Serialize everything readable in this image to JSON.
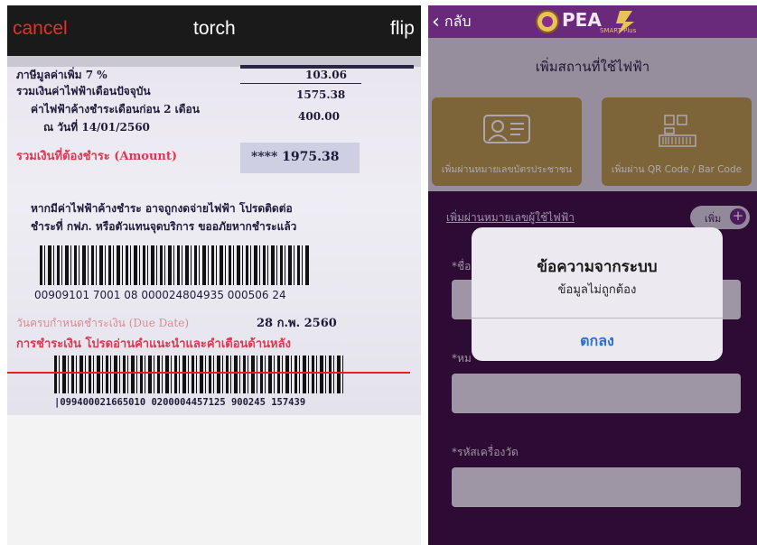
{
  "scanner": {
    "cancel": "cancel",
    "torch": "torch",
    "flip": "flip",
    "bill": {
      "vat_label": "ภาษีมูลค่าเพิ่ม  7 %",
      "vat_value": "103.06",
      "current_label": "รวมเงินค่าไฟฟ้าเดือนปัจจุบัน",
      "current_value": "1575.38",
      "overdue_label": "ค่าไฟฟ้าค้างชำระเดือนก่อน 2 เดือน",
      "overdue_value": "400.00",
      "as_of": "ณ วันที่ 14/01/2560",
      "total_label": "รวมเงินที่ต้องชำระ (Amount)",
      "total_value": "**** 1975.38",
      "notice_line1": "หากมีค่าไฟฟ้าค้างชำระ อาจถูกงดจ่ายไฟฟ้า โปรดติดต่อ",
      "notice_line2": "ชำระที่ กฟภ. หรือตัวแทนจุดบริการ ขออภัยหากชำระแล้ว",
      "barcode1_number": "00909101 7001 08 000024804935 000506 24",
      "due_label": "วันครบกำหนดชำระเงิน (Due Date)",
      "due_value": "28 ก.พ. 2560",
      "payment_note": "การชำระเงิน โปรดอ่านคำแนะนำและคำเตือนด้านหลัง",
      "barcode2_number": "|099400021665010 0200004457125 900245 157439"
    }
  },
  "app": {
    "back_label": "กลับ",
    "logo_text": "PEA",
    "logo_sub": "SMART Plus",
    "page_title": "เพิ่มสถานที่ใช้ไฟฟ้า",
    "tiles": [
      {
        "label": "เพิ่มผ่านหมายเลขบัตรประชาชน",
        "icon": "id-card-icon"
      },
      {
        "label": "เพิ่มผ่าน QR Code / Bar Code",
        "icon": "qr-barcode-icon"
      }
    ],
    "add_link": "เพิ่มผ่านหมายเลขผู้ใช้ไฟฟ้า",
    "add_button": "เพิ่ม",
    "fields": [
      {
        "label": "*ชื่อ"
      },
      {
        "label": "*หม"
      },
      {
        "label": "*รหัสเครื่องวัด"
      }
    ],
    "dialog": {
      "title": "ข้อความจากระบบ",
      "message": "ข้อมูลไม่ถูกต้อง",
      "ok": "ตกลง"
    }
  }
}
